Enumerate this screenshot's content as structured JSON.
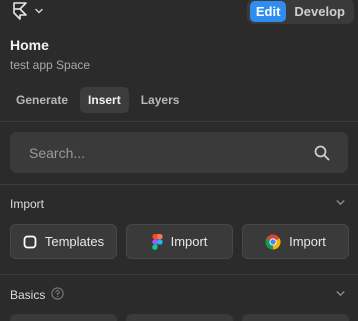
{
  "topbar": {
    "logo_icon": "framer-logo-icon",
    "menu_icon": "chevron-down-icon",
    "modes": [
      {
        "label": "Edit",
        "active": true
      },
      {
        "label": "Develop",
        "active": false
      }
    ]
  },
  "page": {
    "title": "Home",
    "subtitle": "test app Space"
  },
  "tabs": [
    {
      "label": "Generate",
      "active": false
    },
    {
      "label": "Insert",
      "active": true
    },
    {
      "label": "Layers",
      "active": false
    }
  ],
  "search": {
    "placeholder": "Search...",
    "value": "",
    "icon": "search-icon"
  },
  "sections": {
    "import": {
      "label": "Import",
      "toggle_icon": "chevron-down-icon",
      "buttons": [
        {
          "label": "Templates",
          "icon": "templates-icon"
        },
        {
          "label": "Import",
          "icon": "figma-icon"
        },
        {
          "label": "Import",
          "icon": "chrome-icon"
        }
      ]
    },
    "basics": {
      "label": "Basics",
      "help_icon": "help-circle-icon",
      "toggle_icon": "chevron-down-icon"
    }
  },
  "colors": {
    "background": "#2b2b2b",
    "surface": "#3a3a3a",
    "accent": "#2f8df0"
  }
}
